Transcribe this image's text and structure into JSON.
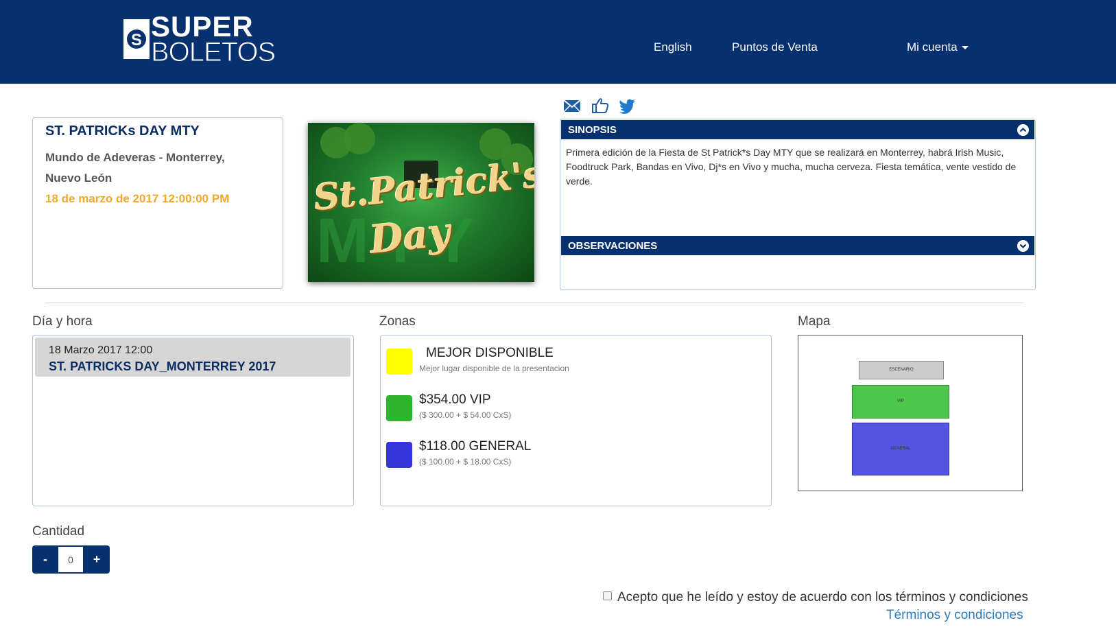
{
  "header": {
    "logo_top": "SUPER",
    "logo_bottom": "BOLETOS",
    "nav": {
      "english": "English",
      "puntos": "Puntos de Venta",
      "cuenta": "Mi cuenta"
    }
  },
  "event": {
    "title": "ST. PATRICKs DAY MTY",
    "venue_line1": "Mundo de Adeveras - Monterrey,",
    "venue_line2": "Nuevo León",
    "date": "18 de marzo de 2017 12:00:00 PM"
  },
  "poster": {
    "line1": "St.Patrick's",
    "line2": "Day",
    "bg_text": "MTY"
  },
  "share_icons": [
    "email-icon",
    "like-icon",
    "twitter-icon"
  ],
  "sinopsis": {
    "title": "SINOPSIS",
    "text": "Primera edición de la Fiesta de St Patrick*s Day MTY que se realizará en Monterrey, habrá Irish Music, Foodtruck Park, Bandas en Vivo, Dj*s en Vivo y mucha, mucha cerveza. Fiesta temática, vente vestido de verde."
  },
  "observaciones": {
    "title": "OBSERVACIONES"
  },
  "sections": {
    "dia": "Día y hora",
    "zonas": "Zonas",
    "mapa": "Mapa",
    "cantidad": "Cantidad"
  },
  "dia_hora": {
    "date": "18 Marzo 2017 12:00",
    "name": "ST. PATRICKS DAY_MONTERREY 2017"
  },
  "zonas": [
    {
      "title": "MEJOR DISPONIBLE",
      "sub": "Mejor lugar disponible de la presentacion",
      "color": "#ffff00"
    },
    {
      "title": "$354.00  VIP",
      "sub": "($ 300.00 + $ 54.00 CxS)",
      "color": "#2db52d"
    },
    {
      "title": "$118.00  GENERAL",
      "sub": "($ 100.00 + $ 18.00 CxS)",
      "color": "#3535d9"
    }
  ],
  "mapa": {
    "escenario": "ESCENARIO",
    "vip": "VIP",
    "general": "GENERAL",
    "colors": {
      "escenario": "#cccccc",
      "vip": "#4cc74c",
      "general": "#5454e4"
    }
  },
  "cantidad": {
    "minus": "-",
    "plus": "+",
    "value": "0"
  },
  "terms": {
    "text": "Acepto que he leído y estoy de acuerdo con los términos y condiciones",
    "link": "Términos y condiciones"
  },
  "colors": {
    "brand": "#06306e",
    "accent": "#f0a92a",
    "link": "#2f7ab8"
  }
}
